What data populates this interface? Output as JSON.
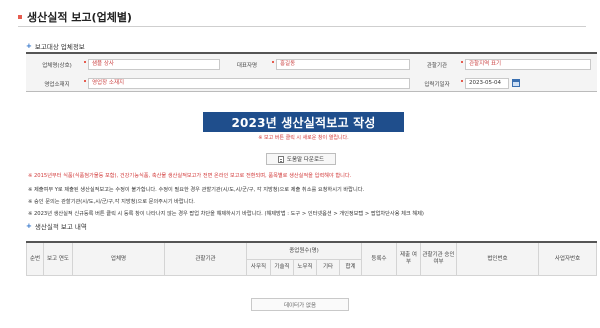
{
  "page": {
    "title": "생산실적 보고(업체별)"
  },
  "company_section": {
    "heading": "보고대상 업체정보",
    "fields": {
      "company_label": "업체명(상호)",
      "company_value": "샘플 상사",
      "rep_label": "대표자명",
      "rep_value": "홍길동",
      "authority_label": "관할기관",
      "authority_value": "관할지역 표기",
      "address_label": "영업소재지",
      "address_value": "영업장 소재지",
      "input_date_label": "입력기일자",
      "input_date_value": "2023-05-04"
    }
  },
  "banner": {
    "title": "2023년 생산실적보고 작성",
    "subtitle": "※ 보고 버튼 클릭 시 새로운 창이 열립니다."
  },
  "download_button": {
    "label": "도움말 다운로드"
  },
  "notes": [
    "※ 2015년부터 식품(식품첨가물등 포함), 건강기능식품, 축산물 생산실적보고가 전면 온라인 보고로 전환되며, 품목별로 생산실적을 입력해야 합니다.",
    "※ 제출여부 Y로 제출된 생산실적보고는 수정이 불가합니다. 수정이 필요한 경우 관할기관(시/도,시/군/구, 각 지방청)으로 제출 취소를 요청하시기 바랍니다.",
    "※ 승인 문의는 관할기관(시/도,시/군/구,각 지방청)으로 문의주시기 바랍니다.",
    "※ 2023년 생산실적 신규등록 버튼 클릭 시 등록 창이 나타나지 않는 경우 팝업 차단을 해제하시기 바랍니다. (해제방법 : 도구 > 인터넷옵션 > 개인정보탭 > 팝업차단사용 체크 해제)"
  ],
  "report_section": {
    "heading": "생산실적 보고 내역",
    "columns": {
      "no": "순번",
      "year": "보고 연도",
      "company": "업체명",
      "authority": "관할기관",
      "employees": "종업원수(명)",
      "office": "사무직",
      "tech": "기술직",
      "labor": "노무직",
      "other": "기타",
      "total": "합계",
      "reg_count": "등록수",
      "submitted": "제출 여부",
      "approved": "관할기관 승인여부",
      "corp_no": "법인번호",
      "biz_no": "사업자번호"
    }
  },
  "more_button": {
    "label": "데이터가 없음"
  },
  "colors": {
    "banner_bg": "#1f4e8c",
    "accent_red": "#d23b3b",
    "plus_blue": "#2a6fc7"
  }
}
